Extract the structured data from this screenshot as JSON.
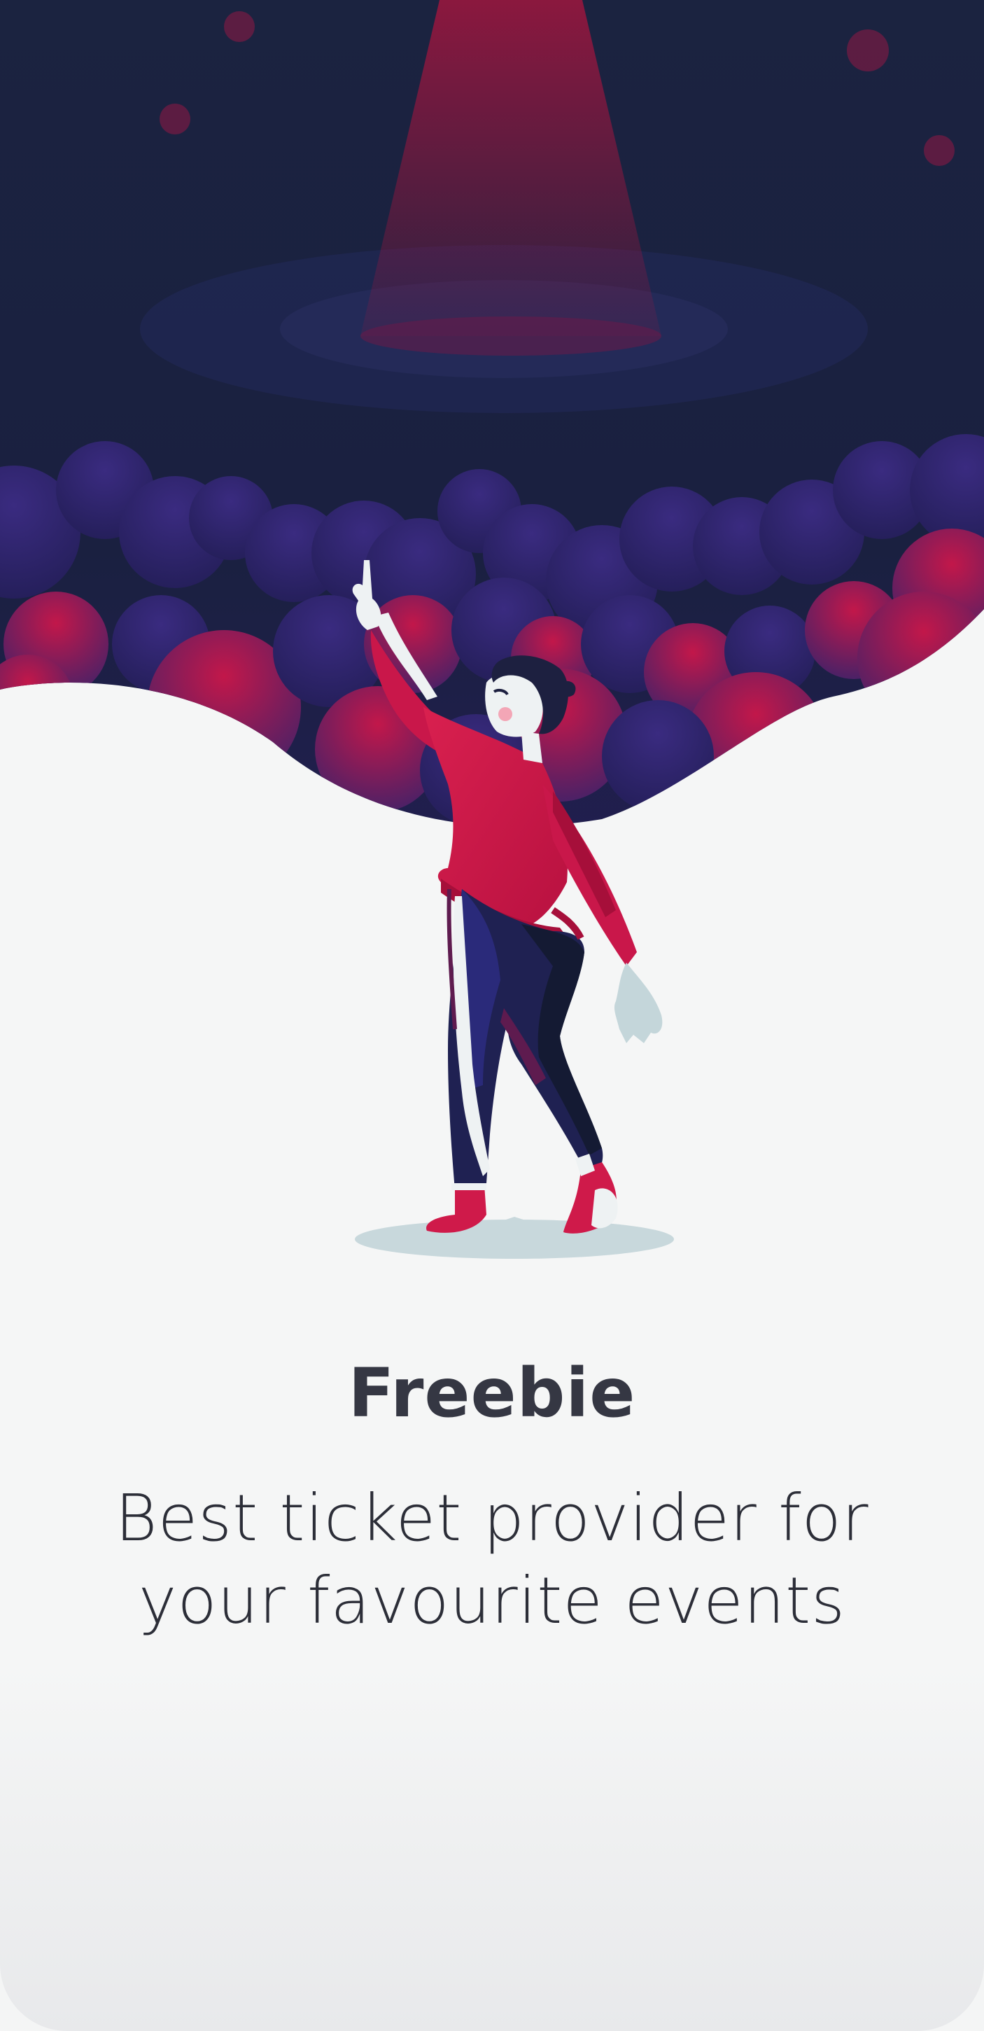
{
  "app": {
    "name": "Freebie"
  },
  "onboarding": {
    "title": "Freebie",
    "subtitle_line1": "Best ticket provider for",
    "subtitle_line2": "your favourite events"
  },
  "illustration": {
    "subject": "person pointing up under a spotlight above a crowd",
    "icon": "concert-illustration"
  },
  "colors": {
    "background": "#f5f6f6",
    "night_sky": "#1b2340",
    "crowd_purple": "#2d2468",
    "accent_red": "#cf1a4a",
    "title_text": "#353743"
  }
}
